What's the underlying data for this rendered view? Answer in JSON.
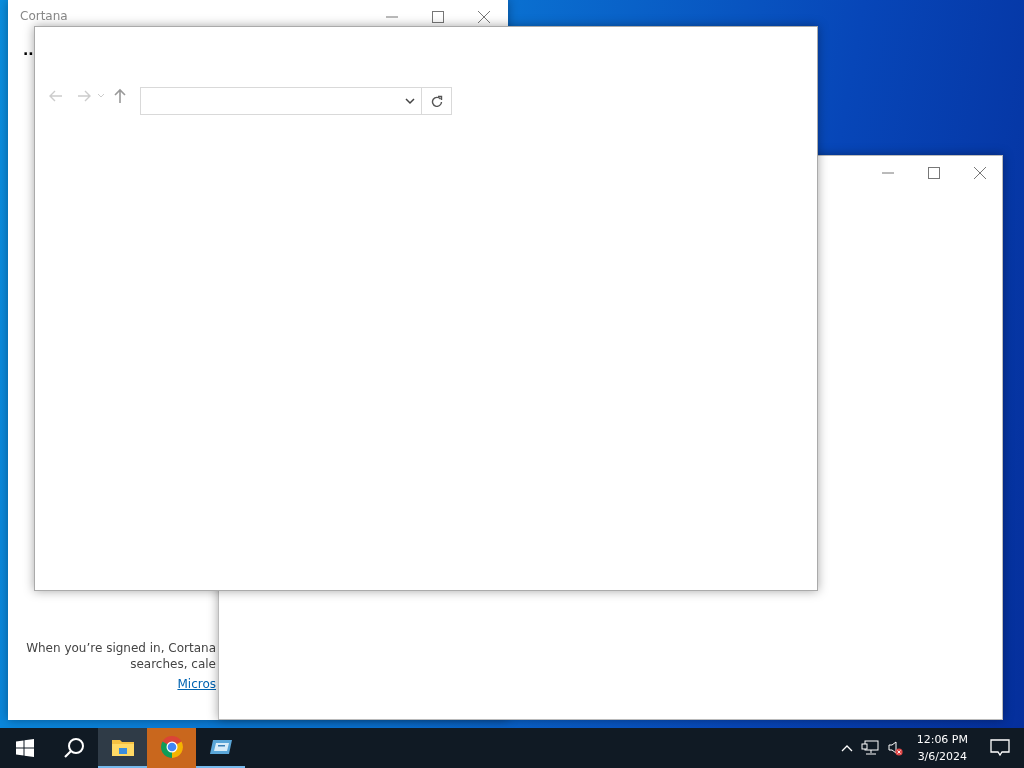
{
  "cortana_window": {
    "title": "Cortana",
    "ellipsis": "..",
    "message_lines": [
      "When you’re signed in, Cortana",
      "searches, cale"
    ],
    "link": "Micros"
  },
  "taskbar": {
    "apps": [
      {
        "kind": "explorer",
        "active": true,
        "flashing": false
      },
      {
        "kind": "chrome",
        "active": false,
        "flashing": true
      },
      {
        "kind": "remote",
        "active": false,
        "flashing": false
      }
    ],
    "tray": {
      "volume_muted": true,
      "time": "12:06 PM",
      "date": "3/6/2024"
    }
  }
}
